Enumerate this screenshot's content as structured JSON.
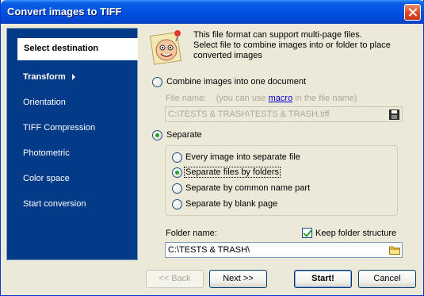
{
  "window": {
    "title": "Convert images to TIFF"
  },
  "sidebar": {
    "items": [
      {
        "label": "Select destination"
      },
      {
        "label": "Transform"
      },
      {
        "label": "Orientation"
      },
      {
        "label": "TIFF Compression"
      },
      {
        "label": "Photometric"
      },
      {
        "label": "Color space"
      },
      {
        "label": "Start conversion"
      }
    ]
  },
  "info": {
    "text_line1": "This file format can support multi-page files.",
    "text_line2": "Select file to combine images into or folder to place",
    "text_line3": "converted images"
  },
  "combine": {
    "label": "Combine images into one document",
    "selected": false,
    "file_name_label": "File name:",
    "file_name_hint_pre": "(you can use",
    "file_name_hint_link": "macro",
    "file_name_hint_post": "in the file name)",
    "file_name_value": "C:\\TESTS & TRASH\\TESTS & TRASH.tiff"
  },
  "separate": {
    "label": "Separate",
    "selected": true,
    "options": [
      {
        "label": "Every image into separate file",
        "selected": false
      },
      {
        "label": "Separate files by folders",
        "selected": true
      },
      {
        "label": "Separate by common name part",
        "selected": false
      },
      {
        "label": "Separate by blank page",
        "selected": false
      }
    ],
    "folder_name_label": "Folder name:",
    "keep_structure_label": "Keep folder structure",
    "keep_structure_checked": true,
    "folder_name_value": "C:\\TESTS & TRASH\\"
  },
  "buttons": {
    "back": "<< Back",
    "next": "Next >>",
    "start": "Start!",
    "cancel": "Cancel"
  }
}
